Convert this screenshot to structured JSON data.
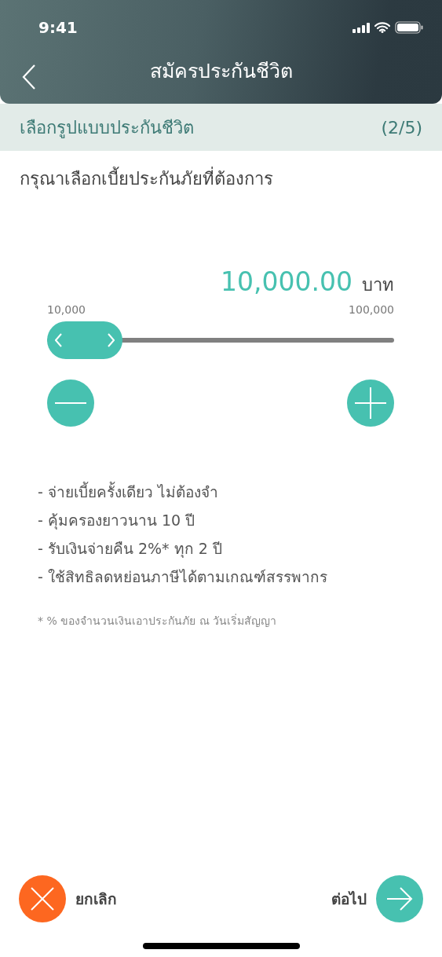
{
  "status_bar": {
    "time": "9:41"
  },
  "nav": {
    "title": "สมัครประกันชีวิต"
  },
  "step": {
    "title": "เลือกรูปแบบประกันชีวิต",
    "counter": "(2/5)"
  },
  "prompt": "กรุณาเลือกเบี้ยประกันภัยที่ต้องการ",
  "amount": {
    "value": "10,000.00",
    "unit": "บาท"
  },
  "slider": {
    "min_label": "10,000",
    "max_label": "100,000",
    "level": 0
  },
  "benefits": [
    "- จ่ายเบี้ยครั้งเดียว ไม่ต้องจำ",
    "- คุ้มครองยาวนาน 10 ปี",
    "- รับเงินจ่ายคืน 2%* ทุก 2 ปี",
    "- ใช้สิทธิลดหย่อนภาษีได้ตามเกณฑ์สรรพากร"
  ],
  "footnote": "* % ของจำนวนเงินเอาประกันภัย ณ วันเริ่มสัญญา",
  "actions": {
    "cancel": "ยกเลิก",
    "next": "ต่อไป"
  }
}
